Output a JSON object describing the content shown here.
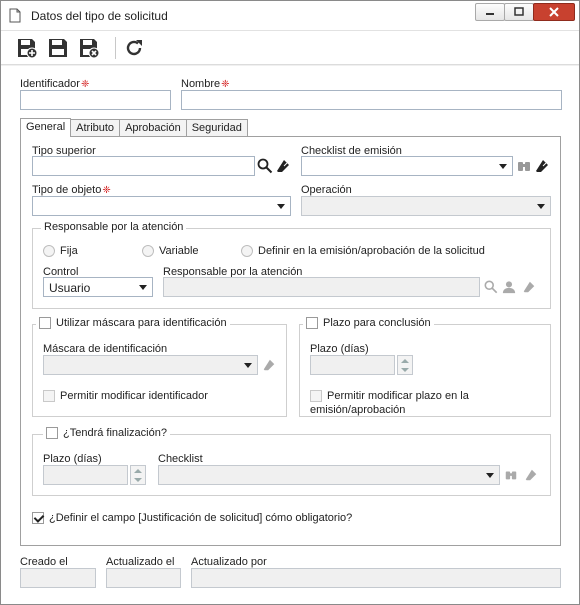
{
  "window": {
    "title": "Datos del tipo de solicitud"
  },
  "toolbar": {
    "icons": [
      "save-new-icon",
      "save-icon",
      "save-close-icon",
      "refresh-icon"
    ]
  },
  "header": {
    "identificador_label": "Identificador",
    "identificador_value": "",
    "nombre_label": "Nombre",
    "nombre_value": ""
  },
  "tabs": [
    {
      "label": "General"
    },
    {
      "label": "Atributo"
    },
    {
      "label": "Aprobación"
    },
    {
      "label": "Seguridad"
    }
  ],
  "general": {
    "tipo_superior_label": "Tipo superior",
    "checklist_emision_label": "Checklist de emisión",
    "tipo_objeto_label": "Tipo de objeto",
    "operacion_label": "Operación",
    "responsable_group": {
      "title": "Responsable por la atención",
      "radios": [
        "Fija",
        "Variable",
        "Definir en la emisión/aprobación de la solicitud"
      ],
      "control_label": "Control",
      "control_value": "Usuario",
      "responsable_label": "Responsable por la atención"
    },
    "mascara_group": {
      "title": "Utilizar máscara para identificación",
      "mascara_label": "Máscara de identificación",
      "permitir_label": "Permitir modificar identificador"
    },
    "plazo_group": {
      "title": "Plazo para conclusión",
      "plazo_label": "Plazo (días)",
      "permitir_line1": "Permitir modificar plazo en la",
      "permitir_line2": "emisión/aprobación"
    },
    "finalizacion_group": {
      "title": "¿Tendrá finalización?",
      "plazo_label": "Plazo (días)",
      "checklist_label": "Checklist"
    },
    "justificacion_label": "¿Definir el campo [Justificación de solicitud] cómo obligatorio?",
    "justificacion_checked": true
  },
  "footer": {
    "creado_label": "Creado el",
    "actualizado_label": "Actualizado el",
    "actualizado_por_label": "Actualizado por"
  },
  "colors": {
    "required": "#d21b1b",
    "close_button": "#c8412f",
    "input_border": "#a7b4c3"
  }
}
